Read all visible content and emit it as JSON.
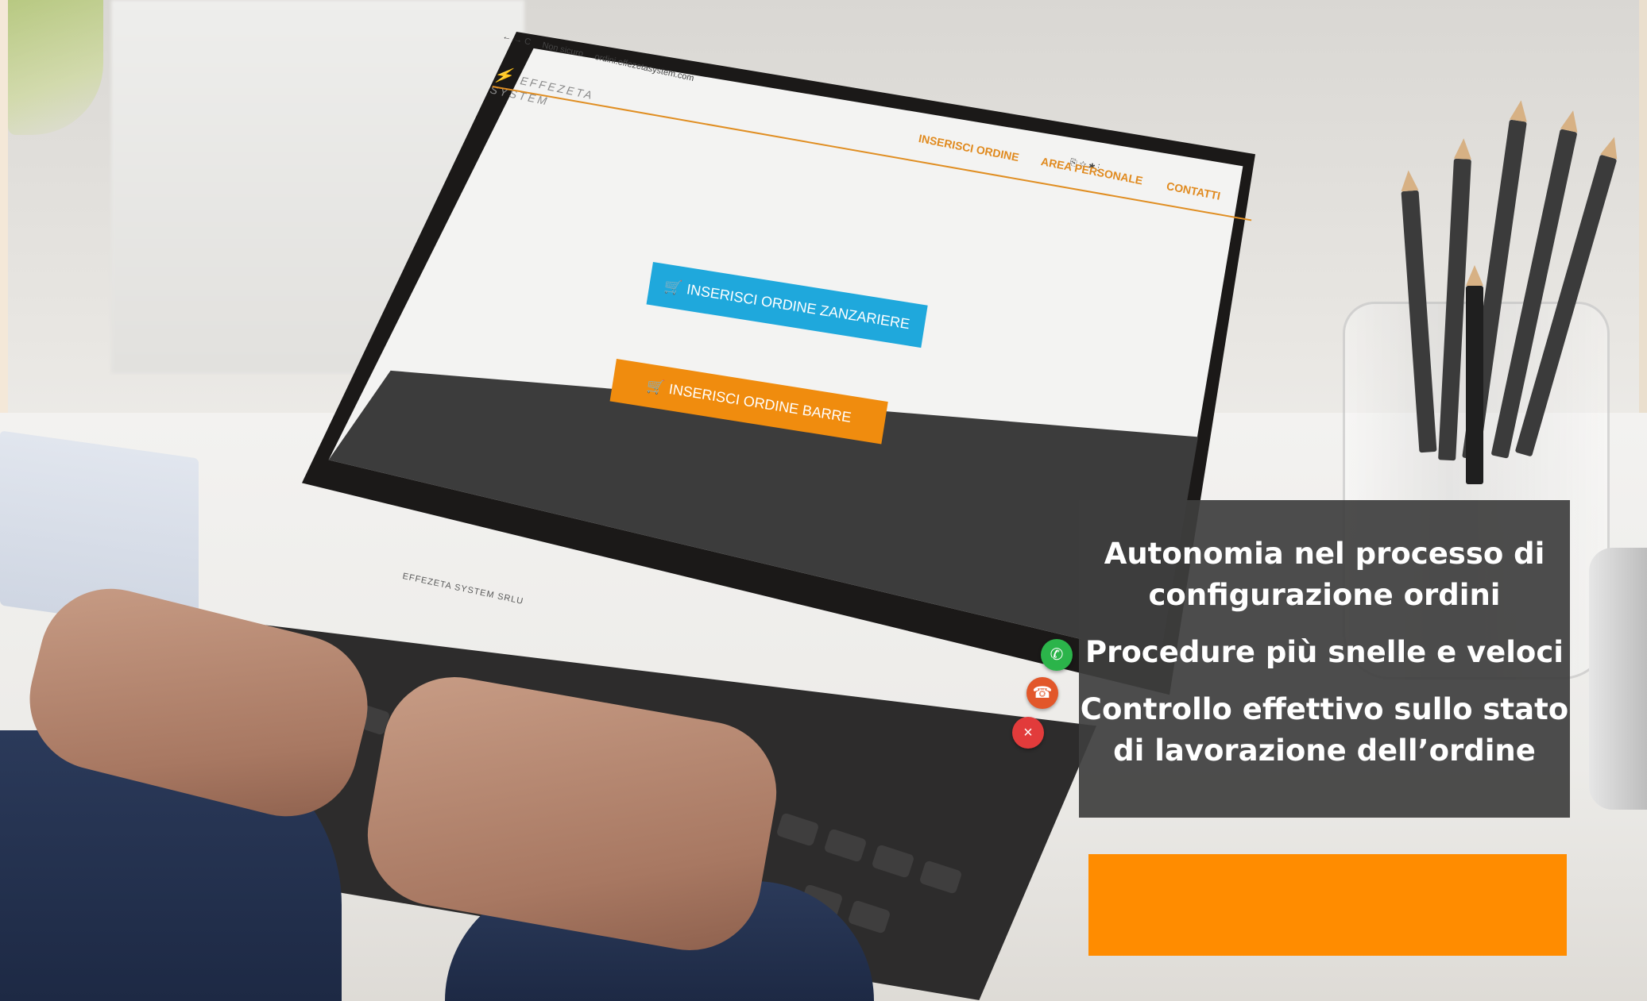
{
  "browser": {
    "nav_icons": "← → C",
    "security_label": "Non sicuro",
    "url": "ordini.effezetasystem.com",
    "toolbar_icons": "⎘ ☆ ✱ ⋮"
  },
  "site": {
    "logo_text": "EFFEZETA",
    "logo_subtext": "SYSTEM",
    "logo_icon": "lightning-bolt-icon",
    "nav": [
      "INSERISCI ORDINE",
      "AREA PERSONALE",
      "CONTATTI"
    ],
    "accent_color": "#e08a1f"
  },
  "main": {
    "btn_zanzariere": "INSERISCI ORDINE ZANZARIERE",
    "btn_zanzariere_color": "#1fa8dc",
    "btn_barre": "INSERISCI ORDINE BARRE",
    "btn_barre_color": "#f08c0e",
    "cart_icon": "cart-icon"
  },
  "footer": {
    "company": "EFFEZETA SYSTEM SRLU"
  },
  "fabs": {
    "whatsapp_icon": "whatsapp-icon",
    "call_icon": "phone-icon",
    "close_icon": "close-icon"
  },
  "overlay": {
    "line_1": "Autonomia nel processo di",
    "line_2": "configurazione ordini",
    "line_3": "Procedure più snelle e veloci",
    "line_4": "Controllo effettivo sullo stato",
    "line_5": "di lavorazione dell’ordine",
    "panel_color": "#3e3e3e",
    "cta_color": "#ff8c00"
  }
}
